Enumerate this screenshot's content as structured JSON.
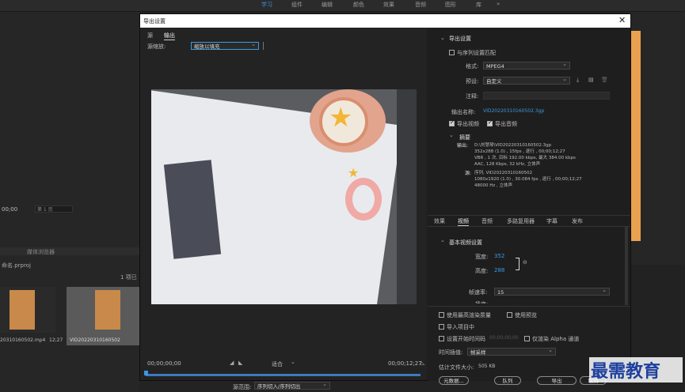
{
  "workspace_tabs": [
    "学习",
    "组件",
    "编辑",
    "颜色",
    "效果",
    "音频",
    "图形",
    "库"
  ],
  "bg": {
    "timecode_left": "00;00",
    "zoom": "第 1 页",
    "project_name": "命名.prproj",
    "items_count": "1 项已",
    "panel_tab": "媒体浏览器",
    "clip1_name": "20310160502.mp4",
    "clip1_duration": "12;27",
    "clip2_name": "VID20220310160502",
    "clip2_duration": "12;27"
  },
  "dialog": {
    "title": "导出设置",
    "left": {
      "tabs": [
        "源",
        "输出"
      ],
      "scale_label": "源缩放:",
      "scale_value": "缩放以填充",
      "timecode_start": "00;00;00;00",
      "fit_value": "适合",
      "timecode_end": "00;00;12;27",
      "range_label": "源范围:",
      "range_value": "序列切入/序列切出"
    },
    "right": {
      "section_title": "导出设置",
      "match_sequence": "与序列设置匹配",
      "format_label": "格式:",
      "format_value": "MPEG4",
      "preset_label": "预设:",
      "preset_value": "自定义",
      "comment_label": "注释:",
      "output_name_label": "输出名称:",
      "output_name_value": "VID20220310160502.3gp",
      "export_video": "导出视频",
      "export_audio": "导出音频",
      "summary_title": "摘要",
      "output_label": "输出:",
      "output_lines": [
        "D:\\刘慧琴\\VID20220310160502.3gp",
        "352x288 (1.0) , 15fps , 逐行 , 00;00;12;27",
        "VBR , 1 次, 目标 192.00 kbps, 最大 384.00 kbps",
        "AAC, 128 Kbps, 32 kHz, 立体声"
      ],
      "source_label": "源:",
      "source_lines": [
        "序列, VID20220310160502",
        "1080x1920 (1.0) , 30.084 fps , 逐行 , 00;00;12;27",
        "48000 Hz , 立体声"
      ],
      "tabs": [
        "效果",
        "视频",
        "音频",
        "多路复用器",
        "字幕",
        "发布"
      ],
      "basic_video_title": "基本视频设置",
      "width_label": "宽度:",
      "width_value": "352",
      "height_label": "高度:",
      "height_value": "288",
      "framerate_label": "帧速率:",
      "framerate_value": "15",
      "field_label": "场序:",
      "max_render": "使用最高渲染质量",
      "use_preview": "使用预览",
      "import_project": "导入项目中",
      "set_start_tc": "设置开始时间码",
      "start_tc_value": "00;00;00;00",
      "render_alpha": "仅渲染 Alpha 通道",
      "interp_label": "时间插值:",
      "interp_value": "帧采样",
      "filesize_label": "估计文件大小:",
      "filesize_value": "505 KB",
      "btn_metadata": "元数据...",
      "btn_queue": "队列",
      "btn_export": "导出",
      "btn_cancel": "取消"
    }
  },
  "watermark": "最需教育",
  "colors": {
    "accent": "#3b9ae1",
    "watermark": "#1d3f9e"
  }
}
